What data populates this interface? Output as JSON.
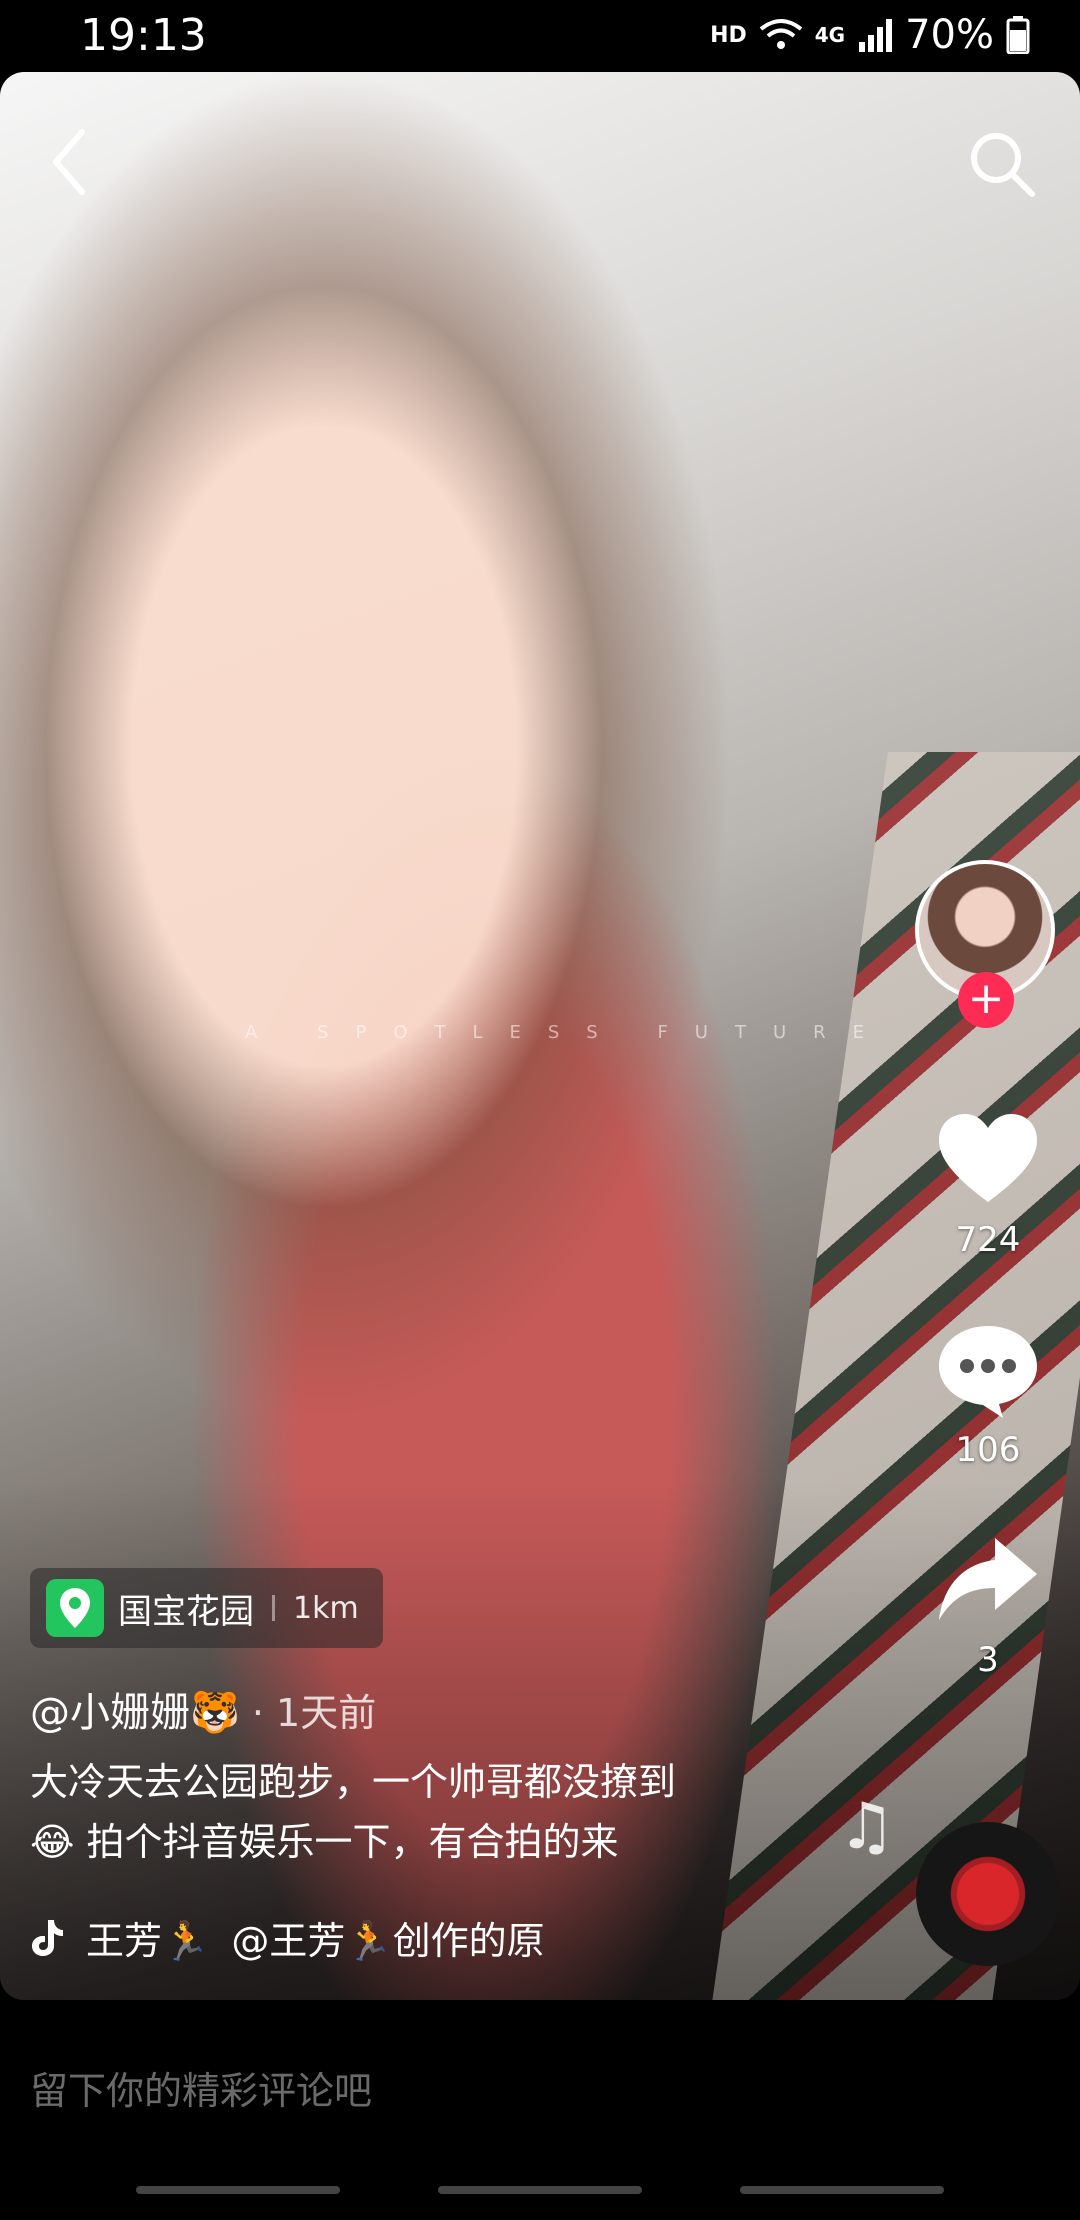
{
  "status_bar": {
    "time": "19:13",
    "hd": "HD",
    "network": "4G",
    "battery": "70%"
  },
  "video": {
    "watermark": "A SPOTLESS FUTURE"
  },
  "actions": {
    "likes": "724",
    "comments": "106",
    "shares": "3",
    "follow_symbol": "+"
  },
  "location": {
    "name": "国宝花园",
    "distance": "1km"
  },
  "post": {
    "author": "@小姗姗🐯",
    "time": " · 1天前",
    "caption_line1": "大冷天去公园跑步，一个帅哥都没撩到",
    "caption_line2": "😂 拍个抖音娱乐一下，有合拍的来",
    "sound_creator": "王芳🏃",
    "sound_text": "@王芳🏃创作的原"
  },
  "comment_input": {
    "placeholder": "留下你的精彩评论吧"
  },
  "colors": {
    "follow": "#fe2c55",
    "location_icon": "#22c55e"
  }
}
